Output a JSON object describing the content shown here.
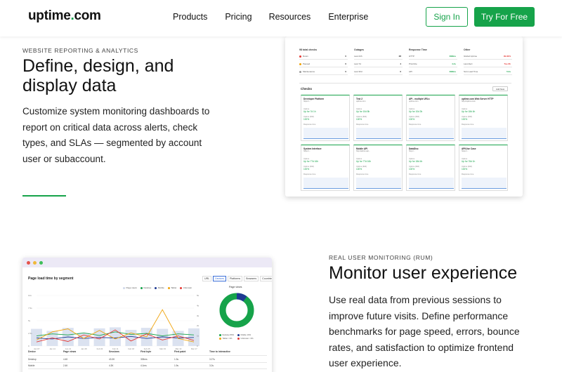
{
  "nav": {
    "logo_text": "uptime",
    "logo_dot": ".",
    "logo_tld": "com",
    "links": [
      "Products",
      "Pricing",
      "Resources",
      "Enterprise"
    ],
    "signin_label": "Sign In",
    "try_label": "Try For Free",
    "brand_color": "#16a34a"
  },
  "section1": {
    "eyebrow": "WEBSITE REPORTING & ANALYTICS",
    "title_line1": "Define, design, and",
    "title_line2": "display data",
    "para_lines": [
      "Customize system monitoring dashboards to",
      "report on critical data across alerts, check",
      "types, and SLAs — segmented by account",
      "user or subaccount."
    ]
  },
  "dashboard": {
    "kpis": [
      {
        "title": "98 total checks",
        "rows": [
          {
            "label": "Down",
            "value": "0",
            "dot": "#e53935"
          },
          {
            "label": "Paused",
            "value": "0",
            "dot": "#f0a30a"
          },
          {
            "label": "Maintenance",
            "value": "0",
            "dot": "#9e9e9e"
          }
        ]
      },
      {
        "title": "Outages",
        "rows": [
          {
            "label": "Last 24h",
            "value": "28"
          },
          {
            "label": "Last 7d",
            "value": "4"
          },
          {
            "label": "Last 30d",
            "value": "0"
          }
        ]
      },
      {
        "title": "Response Time",
        "rows": [
          {
            "label": "HTTP",
            "value": "398ms"
          },
          {
            "label": "Prioritize",
            "value": "4.4s"
          },
          {
            "label": "API",
            "value": "398ms"
          }
        ]
      },
      {
        "title": "Other",
        "rows": [
          {
            "label": "Global Uptime",
            "value": "99.99%"
          },
          {
            "label": "Last Alert",
            "value": "Tue 8h"
          },
          {
            "label": "SLA Load Time",
            "value": "5.0s"
          }
        ]
      }
    ],
    "checks_label": "Checks",
    "add_label": "Add New",
    "cards": [
      {
        "title": "Developer Platform",
        "sub": "https://...",
        "l1": "Uptime",
        "v1": "Up for 7d 1h",
        "l2": "Uptime (30d)",
        "v2": "100%",
        "l3": "Response time"
      },
      {
        "title": "Test 2",
        "sub": "uptime.com",
        "l1": "Uptime",
        "v1": "Up for 10d 8h",
        "l2": "Uptime (30d)",
        "v2": "100%",
        "l3": "Response time"
      },
      {
        "title": "API - multiple URLs",
        "sub": "uptime.com",
        "l1": "Uptime",
        "v1": "Up for 10d 3h",
        "l2": "Uptime (30d)",
        "v2": "100%",
        "l3": "Response time"
      },
      {
        "title": "uptime.com Web Server HTTP",
        "sub": "http://uptime.com",
        "l1": "Uptime",
        "v1": "Up for 18d 4h",
        "l2": "Uptime (30d)",
        "v2": "100%",
        "l3": "Response time"
      },
      {
        "title": "System Interface",
        "sub": "https://...",
        "l1": "Uptime",
        "v1": "Up for 77d 16h",
        "l2": "Uptime (30d)",
        "v2": "100%",
        "l3": "Response time"
      },
      {
        "title": "Mobile API",
        "sub": "http://admin.api...",
        "l1": "Uptime",
        "v1": "Up for 77d 16h",
        "l2": "Uptime (30d)",
        "v2": "100%",
        "l3": "Response time"
      },
      {
        "title": "DataDisc",
        "sub": "http://...",
        "l1": "Uptime",
        "v1": "Up for 18d 4h",
        "l2": "Uptime (30d)",
        "v2": "100%",
        "l3": "Response time"
      },
      {
        "title": "API/Use Case",
        "sub": "https://...",
        "l1": "Uptime",
        "v1": "Up for 76d 1h",
        "l2": "Uptime (30d)",
        "v2": "100%",
        "l3": "Response time"
      }
    ]
  },
  "section2": {
    "eyebrow": "REAL USER MONITORING (RUM)",
    "title": "Monitor user experience",
    "para_lines": [
      "Use real data from previous sessions to",
      "improve future visits. Define performance",
      "benchmarks for page speed, errors, bounce",
      "rates, and satisfaction to optimize frontend",
      "user experience."
    ]
  },
  "rum": {
    "title": "Page load time by segment",
    "tabs": [
      "URL",
      "Devices",
      "Platforms",
      "Browsers",
      "Countries"
    ],
    "active_tab": "Devices",
    "legend": [
      {
        "name": "Page views",
        "color": "#cfd8ea"
      },
      {
        "name": "Desktop",
        "color": "#16a34a"
      },
      {
        "name": "Mobile",
        "color": "#1f3a93"
      },
      {
        "name": "Tablet",
        "color": "#f0a30a"
      },
      {
        "name": "Unknown",
        "color": "#e53935"
      }
    ],
    "x_ticks": [
      "Jan 07",
      "Jan 14",
      "Jan 21",
      "Jan 28",
      "Feb 04",
      "Feb 11",
      "Feb 18",
      "Feb 25",
      "Mar 03",
      "Mar 10",
      "Mar 17"
    ],
    "y_ticks": [
      "10s",
      "7.5s",
      "5s",
      "2.5s",
      "0"
    ],
    "y2_ticks": [
      "5k",
      "4k",
      "3k",
      "2k",
      "1k",
      "0"
    ],
    "donut_label": "Page views",
    "donut_legend": [
      {
        "name": "Desktop 89%",
        "color": "#16a34a"
      },
      {
        "name": "Mobile 10%",
        "color": "#1f3a93"
      },
      {
        "name": "Tablet <1%",
        "color": "#f0a30a"
      },
      {
        "name": "Unknown <1%",
        "color": "#e53935"
      }
    ],
    "table_headers": [
      "Device",
      "Page views",
      "Sessions",
      "First byte",
      "First paint",
      "Time to interactive"
    ],
    "table_rows": [
      [
        "Desktop",
        "4.4K",
        "43.3K",
        "305ms",
        "1.3s",
        "3.27s"
      ],
      [
        "Mobile",
        "2.4K",
        "4.3K",
        "4.1ms",
        "1.9s",
        "3.2s"
      ]
    ]
  },
  "chart_data": {
    "type": "line",
    "title": "Page load time by segment",
    "categories": [
      "Jan 07",
      "Jan 14",
      "Jan 21",
      "Jan 28",
      "Feb 04",
      "Feb 11",
      "Feb 18",
      "Feb 25",
      "Mar 03",
      "Mar 10",
      "Mar 17"
    ],
    "series": [
      {
        "name": "Page views",
        "values": [
          3.4,
          3.0,
          3.6,
          2.6,
          3.5,
          3.7,
          3.2,
          3.6,
          3.4,
          3.0,
          3.5
        ]
      },
      {
        "name": "Desktop",
        "values": [
          2.0,
          2.4,
          2.2,
          2.6,
          2.1,
          2.8,
          2.3,
          2.5,
          2.0,
          2.4,
          2.2
        ]
      },
      {
        "name": "Mobile",
        "values": [
          1.6,
          1.4,
          1.8,
          1.5,
          1.7,
          1.6,
          1.9,
          1.5,
          1.8,
          1.6,
          1.7
        ]
      },
      {
        "name": "Tablet",
        "values": [
          1.2,
          2.8,
          3.4,
          1.5,
          3.1,
          1.4,
          2.6,
          1.8,
          7.2,
          1.5,
          0.8
        ]
      },
      {
        "name": "Unknown",
        "values": [
          0.8,
          1.6,
          0.9,
          2.2,
          1.4,
          3.2,
          1.0,
          2.4,
          1.2,
          2.0,
          1.1
        ]
      }
    ],
    "ylim": [
      0,
      10
    ]
  }
}
